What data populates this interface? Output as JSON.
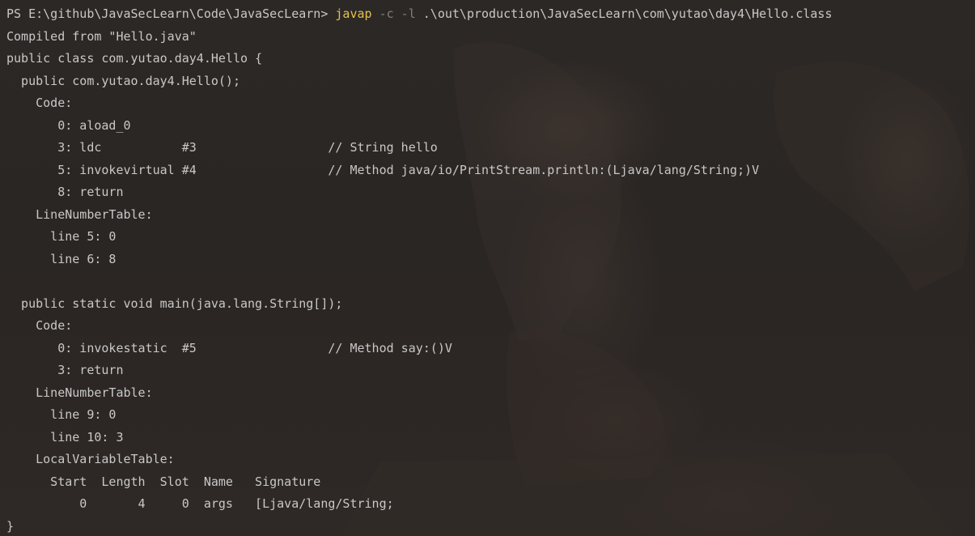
{
  "terminal": {
    "prompt": "PS E:\\github\\JavaSecLearn\\Code\\JavaSecLearn> ",
    "command": "javap",
    "flags": " -c -l ",
    "argument": ".\\out\\production\\JavaSecLearn\\com\\yutao\\day4\\Hello.class",
    "output_lines": [
      "Compiled from \"Hello.java\"",
      "public class com.yutao.day4.Hello {",
      "  public com.yutao.day4.Hello();",
      "    Code:",
      "       0: aload_0",
      "       3: ldc           #3                  // String hello",
      "       5: invokevirtual #4                  // Method java/io/PrintStream.println:(Ljava/lang/String;)V",
      "       8: return",
      "    LineNumberTable:",
      "      line 5: 0",
      "      line 6: 8",
      "",
      "  public static void main(java.lang.String[]);",
      "    Code:",
      "       0: invokestatic  #5                  // Method say:()V",
      "       3: return",
      "    LineNumberTable:",
      "      line 9: 0",
      "      line 10: 3",
      "    LocalVariableTable:",
      "      Start  Length  Slot  Name   Signature",
      "          0       4     0  args   [Ljava/lang/String;",
      "}"
    ]
  },
  "colors": {
    "background": "#2a2624",
    "text": "#c8c8c8",
    "command": "#e5c14d",
    "flags": "#7f7f7f"
  }
}
